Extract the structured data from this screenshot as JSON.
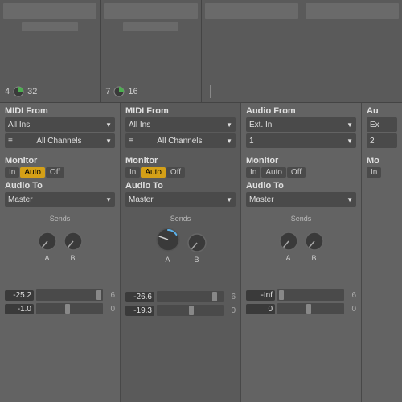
{
  "channels": [
    {
      "id": "ch1",
      "number": "4",
      "bpm": "32",
      "routingType": "MIDI From",
      "routingSource": "All Ins",
      "subRouting": "All Channels",
      "subRoutingIcon": "≡",
      "monitor": {
        "label": "Monitor",
        "buttons": [
          "In",
          "Auto",
          "Off"
        ],
        "active": "Auto"
      },
      "audioTo": "Audio To",
      "audioToValue": "Master",
      "sends": {
        "label": "Sends",
        "knobA": {
          "label": "A",
          "angle": 220
        },
        "knobB": {
          "label": "B",
          "angle": 220
        }
      },
      "volume": "-25.2",
      "volumeMax": "6",
      "pan": "-1.0",
      "panMax": "0",
      "isActive": false
    },
    {
      "id": "ch2",
      "number": "7",
      "bpm": "16",
      "routingType": "MIDI From",
      "routingSource": "All Ins",
      "subRouting": "All Channels",
      "subRoutingIcon": "≡",
      "monitor": {
        "label": "Monitor",
        "buttons": [
          "In",
          "Auto",
          "Off"
        ],
        "active": "Auto"
      },
      "audioTo": "Audio To",
      "audioToValue": "Master",
      "sends": {
        "label": "Sends",
        "knobA": {
          "label": "A",
          "angle": 290
        },
        "knobB": {
          "label": "B",
          "angle": 220
        }
      },
      "volume": "-26.6",
      "volumeMax": "6",
      "pan": "-19.3",
      "panMax": "0",
      "isActive": true
    },
    {
      "id": "ch3",
      "number": "",
      "bpm": "",
      "routingType": "Audio From",
      "routingSource": "Ext. In",
      "subRouting": "1",
      "subRoutingIcon": "",
      "monitor": {
        "label": "Monitor",
        "buttons": [
          "In",
          "Auto",
          "Off"
        ],
        "active": null
      },
      "audioTo": "Audio To",
      "audioToValue": "Master",
      "sends": {
        "label": "Sends",
        "knobA": {
          "label": "A",
          "angle": 220
        },
        "knobB": {
          "label": "B",
          "angle": 220
        }
      },
      "volume": "-Inf",
      "volumeMax": "6",
      "pan": "0",
      "panMax": "0",
      "isActive": false
    },
    {
      "id": "ch4",
      "number": "",
      "bpm": "",
      "routingType": "Au",
      "routingSource": "Ex",
      "subRouting": "2",
      "subRoutingIcon": "",
      "monitor": {
        "label": "Mo",
        "buttons": [
          "In"
        ],
        "active": null
      },
      "audioTo": "",
      "audioToValue": "",
      "sends": {
        "label": "",
        "knobA": {
          "label": "",
          "angle": 220
        },
        "knobB": {
          "label": "",
          "angle": 220
        }
      },
      "volume": "",
      "volumeMax": "",
      "pan": "",
      "panMax": "",
      "isActive": false,
      "partial": true
    }
  ],
  "ui": {
    "backgroundColor": "#636363",
    "activeChannelColor": "#5a5a5a",
    "dropdownBg": "#4a4a4a",
    "activeButtonColor": "#d4a017"
  }
}
